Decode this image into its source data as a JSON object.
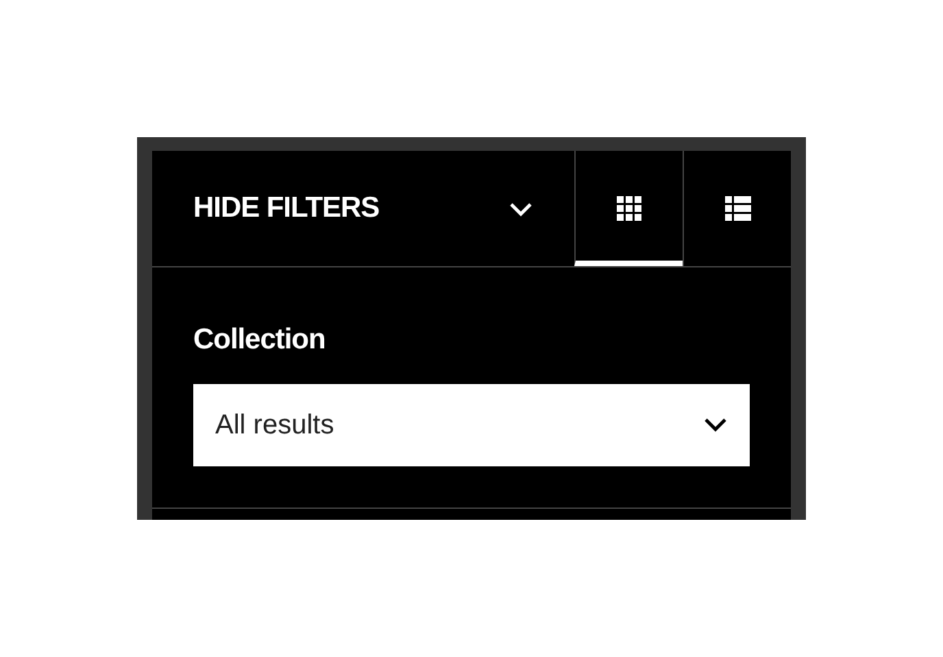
{
  "toggle": {
    "label": "HIDE FILTERS",
    "expanded": true
  },
  "view_modes": [
    {
      "kind": "grid",
      "selected": true
    },
    {
      "kind": "list",
      "selected": false
    }
  ],
  "filter": {
    "label": "Collection",
    "value": "All results"
  }
}
